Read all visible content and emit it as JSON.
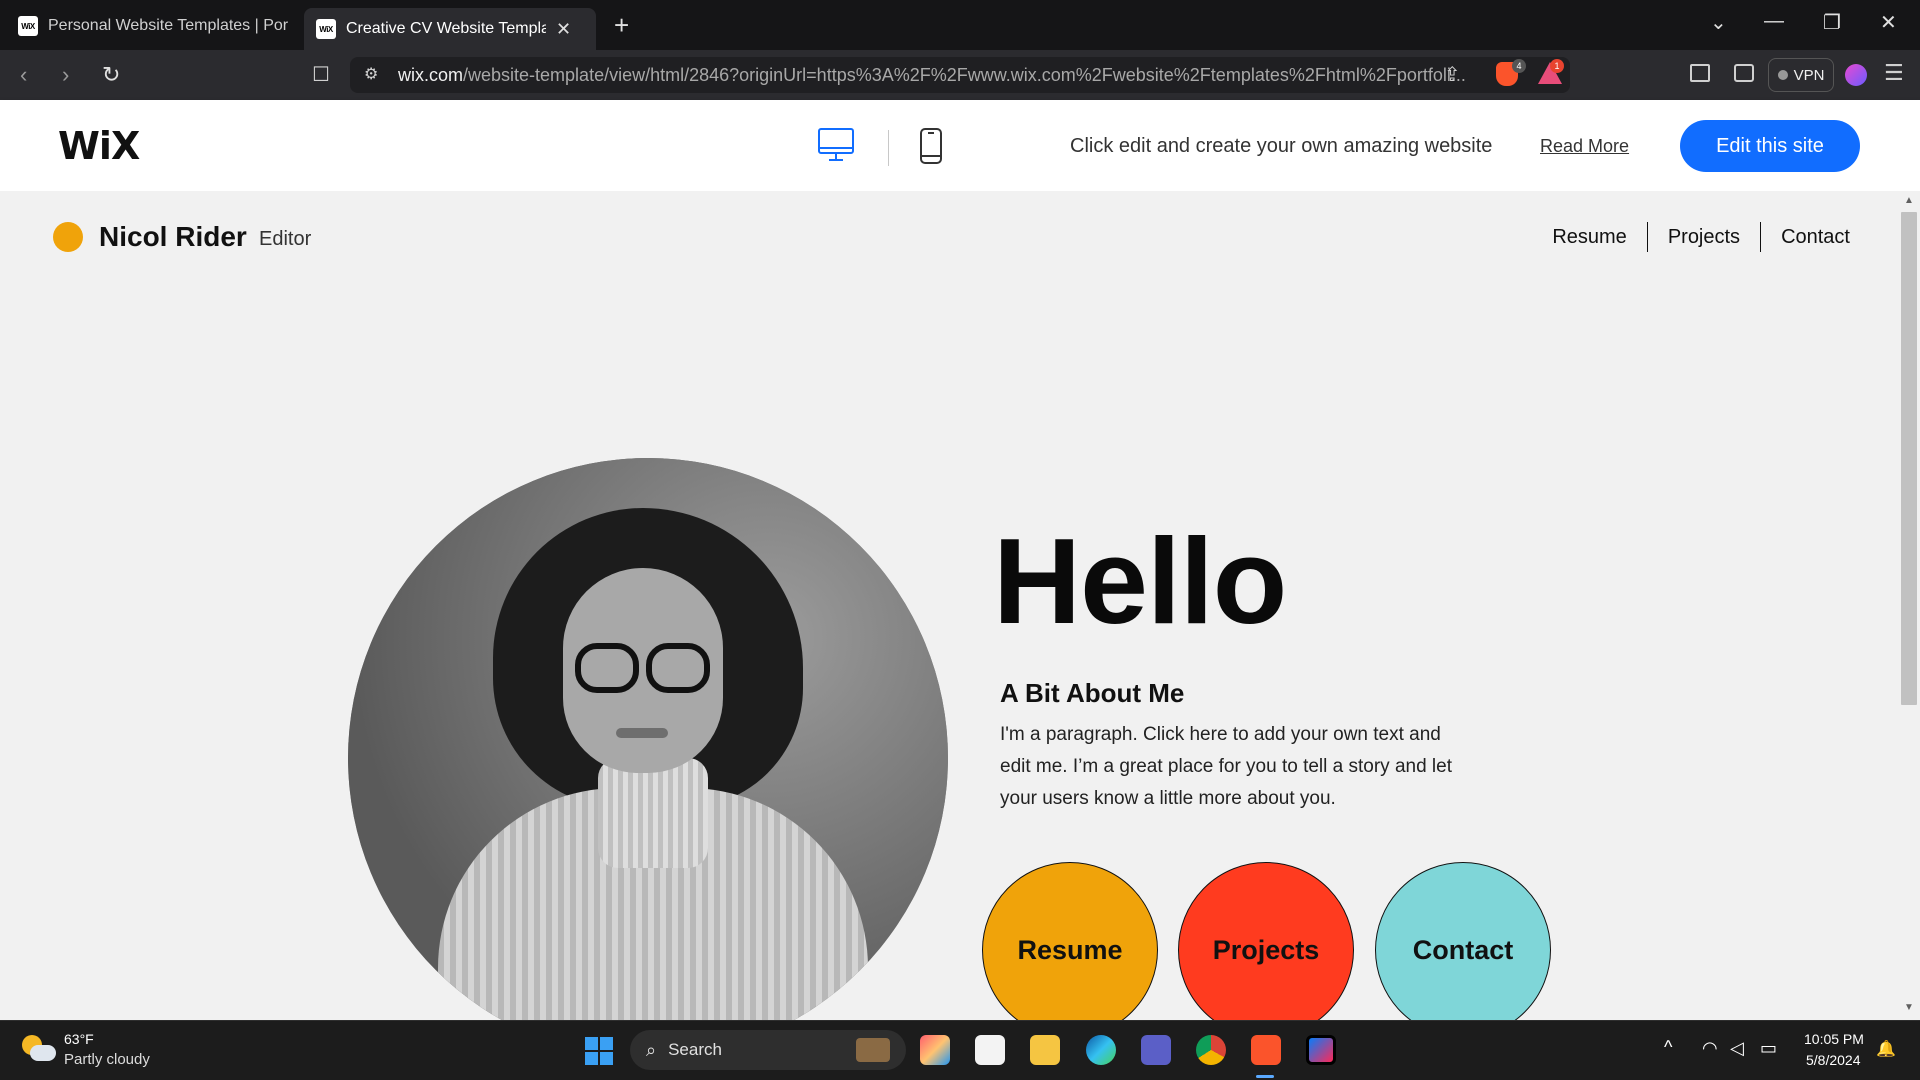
{
  "browser": {
    "tabs": [
      {
        "title": "Personal Website Templates | Portfoli",
        "favicon": "wix-favicon",
        "active": false
      },
      {
        "title": "Creative CV Website Template | ",
        "favicon": "wix-favicon",
        "active": true
      }
    ],
    "favicon_text": "WiX",
    "new_tab_glyph": "+",
    "url_host": "wix.com",
    "url_path": "/website-template/view/html/2846?originUrl=https%3A%2F%2Fwww.wix.com%2Fwebsite%2Ftemplates%2Fhtml%2Fportfoli...",
    "brave_shield_count": "4",
    "rewards_count": "1",
    "vpn_label": "VPN"
  },
  "wix_bar": {
    "logo": "WiX",
    "tagline": "Click edit and create your own amazing website",
    "read_more": "Read More",
    "edit_button": "Edit this site",
    "accent": "#116dff"
  },
  "site": {
    "brand_name": "Nicol Rider",
    "brand_role": "Editor",
    "nav": [
      "Resume",
      "Projects",
      "Contact"
    ],
    "hero_heading": "Hello",
    "about_title": "A Bit About Me",
    "about_text": "I'm a paragraph. Click here to add your own text and edit me. I’m a great place for you to tell a story and let your users know a little more about you.",
    "buttons": [
      {
        "label": "Resume",
        "color": "#f0a30a"
      },
      {
        "label": "Projects",
        "color": "#ff3b1f"
      },
      {
        "label": "Contact",
        "color": "#7fd6d8"
      }
    ],
    "brand_dot_color": "#f0a30a"
  },
  "taskbar": {
    "weather_temp": "63°F",
    "weather_desc": "Partly cloudy",
    "search_label": "Search",
    "time": "10:05 PM",
    "date": "5/8/2024"
  }
}
